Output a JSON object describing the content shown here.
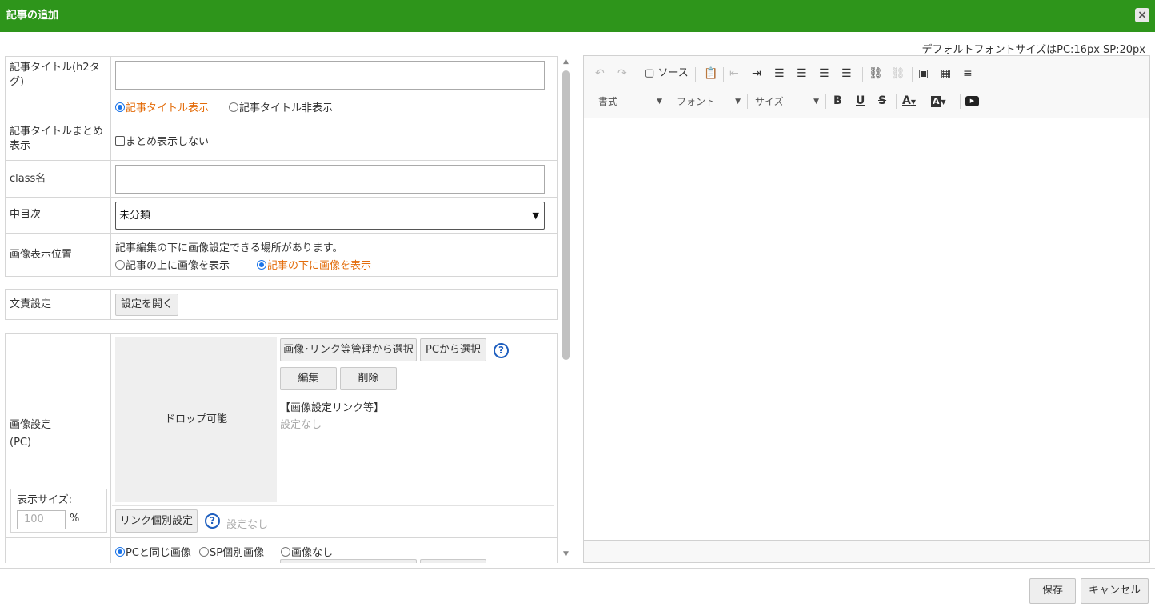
{
  "dialog": {
    "title": "記事の追加",
    "close_icon": "×",
    "font_note": "デフォルトフォントサイズはPC:16px SP:20px"
  },
  "form": {
    "title_label": "記事タイトル(h2タグ)",
    "title_value": "",
    "title_display": {
      "show": "記事タイトル表示",
      "hide": "記事タイトル非表示",
      "selected": "show"
    },
    "summary_label": "記事タイトルまとめ表示",
    "summary_checkbox": "まとめ表示しない",
    "class_label": "class名",
    "class_value": "",
    "toc_label": "中目次",
    "toc_selected": "未分類",
    "image_pos_label": "画像表示位置",
    "image_pos_note": "記事編集の下に画像設定できる場所があります。",
    "image_pos_above": "記事の上に画像を表示",
    "image_pos_below": "記事の下に画像を表示",
    "image_pos_selected": "below",
    "text_settings_label": "文責設定",
    "open_settings_button": "設定を開く",
    "image_pc_label_1": "画像設定",
    "image_pc_label_2": "(PC)",
    "drop_text": "ドロップ可能",
    "select_managed_button": "画像･リンク等管理から選択",
    "select_pc_button": "PCから選択",
    "help_icon": "?",
    "edit_button": "編集",
    "delete_button": "削除",
    "link_heading": "【画像設定リンク等】",
    "no_setting": "設定なし",
    "display_size_label": "表示サイズ:",
    "display_size_placeholder": "100",
    "percent": "%",
    "link_individual_button": "リンク個別設定",
    "link_no_setting": "設定なし",
    "sp_same": "PCと同じ画像",
    "sp_individual": "SP個別画像",
    "sp_none": "画像なし"
  },
  "editor": {
    "source_label": "ソース",
    "format_label": "書式",
    "font_label": "フォント",
    "size_label": "サイズ",
    "bold": "B",
    "underline": "U",
    "strike": "S",
    "text_color": "A",
    "bg_color": "A"
  },
  "footer": {
    "save": "保存",
    "cancel": "キャンセル"
  }
}
